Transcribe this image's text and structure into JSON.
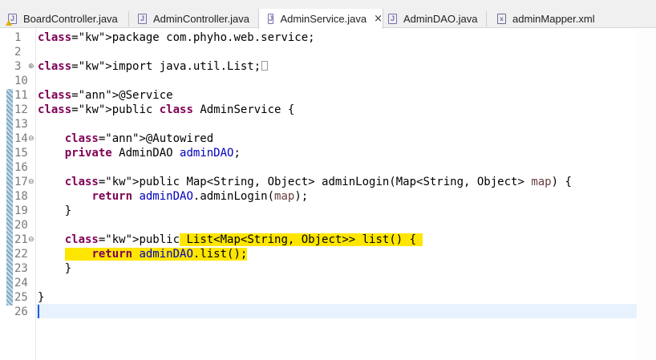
{
  "tabs": [
    {
      "label": "BoardController.java",
      "icon": "java-file-warning-icon",
      "active": false
    },
    {
      "label": "AdminController.java",
      "icon": "java-file-icon",
      "active": false
    },
    {
      "label": "AdminService.java",
      "icon": "java-file-icon",
      "active": true,
      "close": "×"
    },
    {
      "label": "AdminDAO.java",
      "icon": "java-file-icon",
      "active": false
    },
    {
      "label": "adminMapper.xml",
      "icon": "xml-file-icon",
      "active": false
    }
  ],
  "editor": {
    "lines": [
      {
        "num": "1",
        "text": "package com.phyho.web.service;"
      },
      {
        "num": "2",
        "text": ""
      },
      {
        "num": "3",
        "text": "import java.util.List;"
      },
      {
        "num": "10",
        "text": ""
      },
      {
        "num": "11",
        "text": "@Service"
      },
      {
        "num": "12",
        "text": "public class AdminService {"
      },
      {
        "num": "13",
        "text": ""
      },
      {
        "num": "14",
        "text": "    @Autowired"
      },
      {
        "num": "15",
        "text": "    private AdminDAO adminDAO;"
      },
      {
        "num": "16",
        "text": ""
      },
      {
        "num": "17",
        "text": "    public Map<String, Object> adminLogin(Map<String, Object> map) {"
      },
      {
        "num": "18",
        "text": "        return adminDAO.adminLogin(map);"
      },
      {
        "num": "19",
        "text": "    }"
      },
      {
        "num": "20",
        "text": ""
      },
      {
        "num": "21",
        "text": "    public List<Map<String, Object>> list() {"
      },
      {
        "num": "22",
        "text": "        return adminDAO.list();"
      },
      {
        "num": "23",
        "text": "    }"
      },
      {
        "num": "24",
        "text": ""
      },
      {
        "num": "25",
        "text": "}"
      },
      {
        "num": "26",
        "text": ""
      }
    ],
    "current_line": "26",
    "colors": {
      "keyword": "#7f0055",
      "annotation": "#646464",
      "field": "#0000c0",
      "param": "#6a3e3e",
      "highlight": "#ffe600",
      "current_line": "#e8f2fe"
    }
  }
}
